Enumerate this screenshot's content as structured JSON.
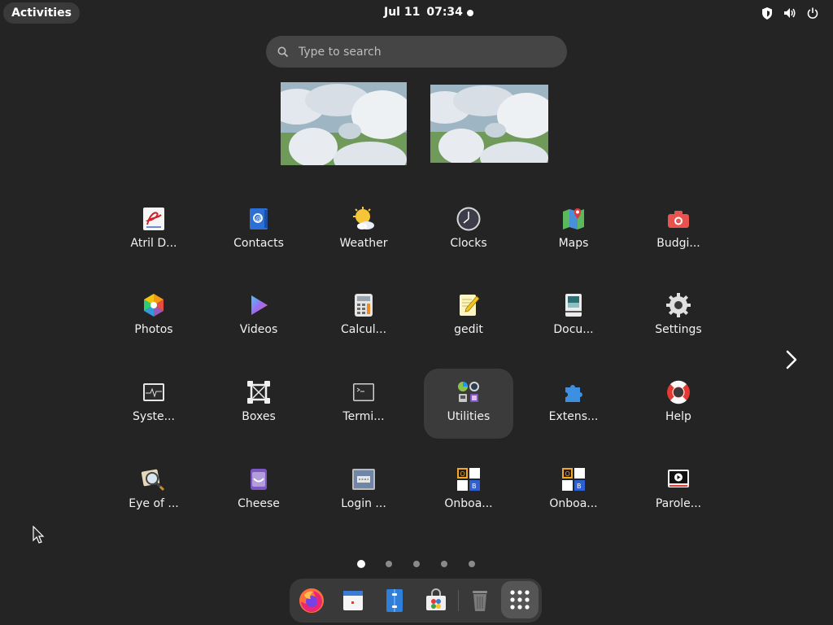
{
  "topbar": {
    "activities_label": "Activities",
    "date": "Jul 11",
    "time": "07:34"
  },
  "search": {
    "placeholder": "Type to search"
  },
  "apps": [
    {
      "label": "Atril D...",
      "icon": "atril-document-viewer-icon"
    },
    {
      "label": "Contacts",
      "icon": "contacts-icon"
    },
    {
      "label": "Weather",
      "icon": "weather-icon"
    },
    {
      "label": "Clocks",
      "icon": "clocks-icon"
    },
    {
      "label": "Maps",
      "icon": "maps-icon"
    },
    {
      "label": "Budgi...",
      "icon": "budgie-screenshot-icon"
    },
    {
      "label": "Photos",
      "icon": "photos-icon"
    },
    {
      "label": "Videos",
      "icon": "videos-icon"
    },
    {
      "label": "Calcul...",
      "icon": "calculator-icon"
    },
    {
      "label": "gedit",
      "icon": "gedit-icon"
    },
    {
      "label": "Docu...",
      "icon": "document-scanner-icon"
    },
    {
      "label": "Settings",
      "icon": "settings-gear-icon"
    },
    {
      "label": "Syste...",
      "icon": "system-monitor-icon"
    },
    {
      "label": "Boxes",
      "icon": "boxes-icon"
    },
    {
      "label": "Termi...",
      "icon": "terminal-icon"
    },
    {
      "label": "Utilities",
      "icon": "utilities-folder-icon"
    },
    {
      "label": "Extens...",
      "icon": "extensions-puzzle-icon"
    },
    {
      "label": "Help",
      "icon": "help-lifebuoy-icon"
    },
    {
      "label": "Eye of ...",
      "icon": "eye-of-gnome-icon"
    },
    {
      "label": "Cheese",
      "icon": "cheese-icon"
    },
    {
      "label": "Login ...",
      "icon": "login-window-icon"
    },
    {
      "label": "Onboa...",
      "icon": "onboard-keyboard-icon"
    },
    {
      "label": "Onboa...",
      "icon": "onboard-settings-icon"
    },
    {
      "label": "Parole...",
      "icon": "parole-media-player-icon"
    }
  ],
  "pager": {
    "pages": 5,
    "current": 1
  },
  "dock": [
    {
      "name": "firefox-icon"
    },
    {
      "name": "calendar-icon"
    },
    {
      "name": "files-icon"
    },
    {
      "name": "software-store-icon"
    },
    {
      "name": "trash-icon"
    },
    {
      "name": "show-apps-grid-icon"
    }
  ],
  "colors": {
    "background": "#242424",
    "highlight": "#3b3b3b",
    "dock": "#393939"
  }
}
